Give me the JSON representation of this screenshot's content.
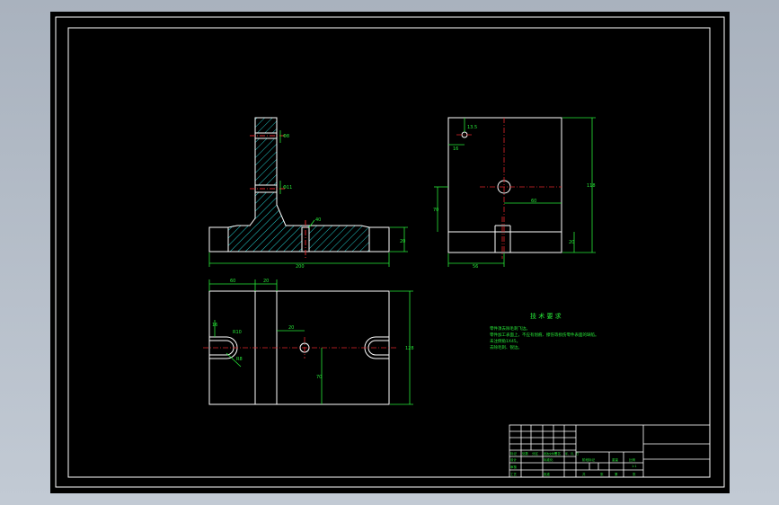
{
  "drawing": {
    "background": "#000000",
    "line_color": "#ffffff",
    "dimension_color": "#27e838",
    "centerline_color": "#e0262b",
    "hatch_color": "#22c7c7"
  },
  "dimensions": {
    "front_view": {
      "hole_upper": "Φ8",
      "hole_lower": "Φ11",
      "slot_depth": "40",
      "base_height": "20",
      "overall_width": "200"
    },
    "side_view": {
      "hole_offset_y": "13.5",
      "hole_offset_x": "16",
      "hole_height": "70",
      "hole_center_x": "60",
      "overall_height": "118",
      "base_width": "56",
      "left_step": "20"
    },
    "top_view": {
      "left_part": "60",
      "step": "20",
      "slot_width": "16",
      "slot_radius": "R10",
      "slot_radius_2": "R8",
      "hole_x": "20",
      "hole_y": "70",
      "overall_height": "128"
    }
  },
  "technical_requirements": {
    "title": "技 术 要 求",
    "items": [
      "零件须去除毛刺飞边。",
      "零件加工表面上，不应有划痕、擦伤等损伤零件表面的缺陷。",
      "未注倒角1X45。",
      "去除毛刺、锐边。"
    ]
  },
  "title_block": {
    "labels": [
      "标记",
      "处数",
      "分区",
      "更改文件号",
      "签名",
      "年、月、日",
      "设计",
      "标准化",
      "阶段标记",
      "重量",
      "比例",
      "审核",
      "工艺",
      "批准",
      "共",
      "张",
      "第",
      "张"
    ],
    "scale": "1:1"
  }
}
